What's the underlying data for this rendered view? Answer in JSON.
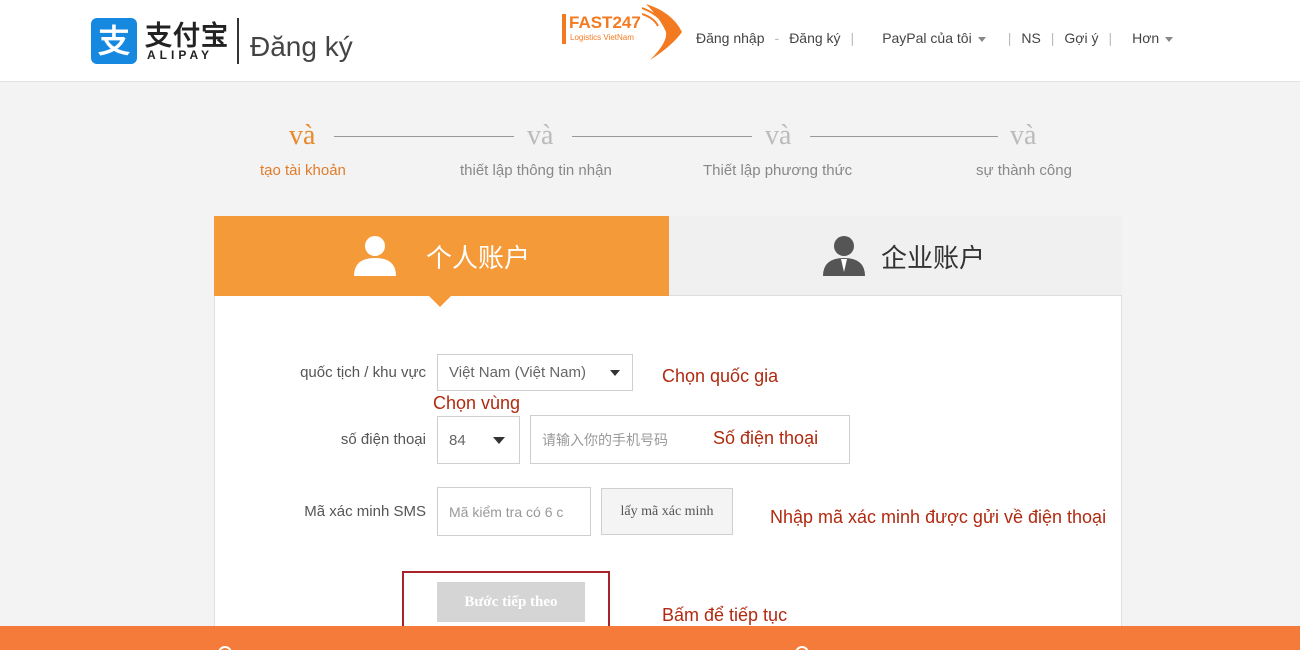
{
  "header": {
    "logo_cn": "支付宝",
    "logo_en": "ALIPAY",
    "logo_mark": "支",
    "page_title": "Đăng ký",
    "watermark": {
      "name": "FAST247",
      "tagline": "Logistics VietNam"
    },
    "nav": {
      "login": "Đăng nhập",
      "register": "Đăng ký",
      "my_paypal": "PayPal của tôi",
      "ns": "NS",
      "suggest": "Gợi ý",
      "more": "Hơn"
    }
  },
  "steps": [
    {
      "mark": "và",
      "label": "tạo tài khoản",
      "active": true
    },
    {
      "mark": "và",
      "label": "thiết lập thông tin nhận",
      "active": false
    },
    {
      "mark": "và",
      "label": "Thiết lập phương thức",
      "active": false
    },
    {
      "mark": "và",
      "label": "sự thành công",
      "active": false
    }
  ],
  "tabs": {
    "personal": "个人账户",
    "business": "企业账户"
  },
  "form": {
    "country_label": "quốc tịch / khu vực",
    "country_value": "Việt Nam (Việt Nam)",
    "phone_label": "số điện thoại",
    "phone_code": "84",
    "phone_placeholder": "请输入你的手机号码",
    "sms_label": "Mã xác minh SMS",
    "sms_placeholder": "Mã kiểm tra có 6 c",
    "sms_button": "lấy mã xác minh",
    "next_button": "Bước tiếp theo"
  },
  "annotations": {
    "choose_country": "Chọn quốc gia",
    "choose_region": "Chọn vùng",
    "phone_number": "Số điện thoại",
    "enter_code": "Nhập mã xác minh được gửi về điện thoại",
    "click_continue": "Bấm để tiếp tục"
  },
  "colors": {
    "accent_orange": "#f59a38",
    "alipay_blue": "#1688e0",
    "annotation_red": "#b02a10",
    "footer_orange": "#f47b3a"
  }
}
